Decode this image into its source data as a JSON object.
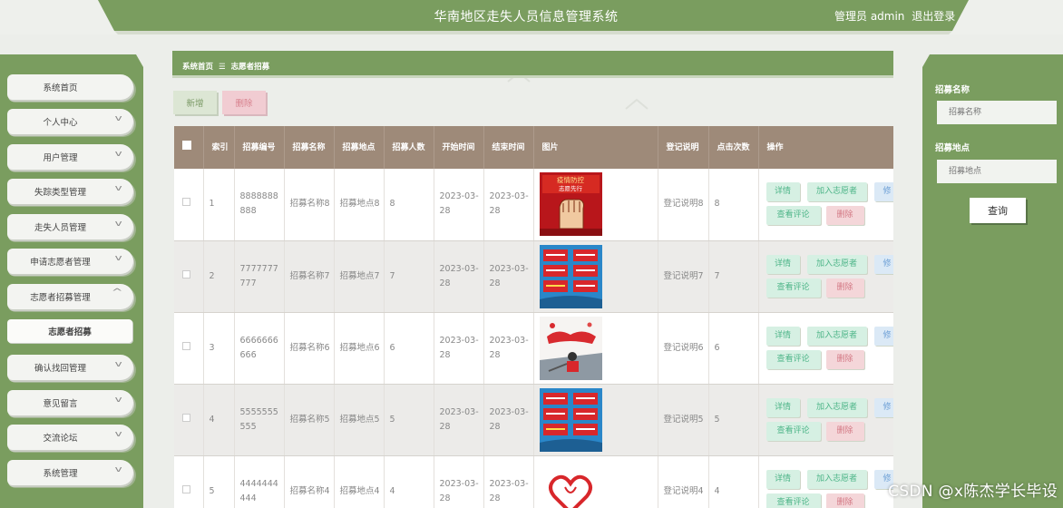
{
  "header": {
    "app_title": "华南地区走失人员信息管理系统",
    "user_label": "管理员 admin",
    "logout_label": "退出登录"
  },
  "sidebar": {
    "items": [
      {
        "label": "系统首页",
        "has_arrow": false
      },
      {
        "label": "个人中心",
        "has_arrow": true
      },
      {
        "label": "用户管理",
        "has_arrow": true
      },
      {
        "label": "失踪类型管理",
        "has_arrow": true
      },
      {
        "label": "走失人员管理",
        "has_arrow": true
      },
      {
        "label": "申请志愿者管理",
        "has_arrow": true
      },
      {
        "label": "志愿者招募管理",
        "has_arrow": true,
        "expanded": true
      },
      {
        "label": "志愿者招募",
        "sub": true
      },
      {
        "label": "确认找回管理",
        "has_arrow": true
      },
      {
        "label": "意见留言",
        "has_arrow": true
      },
      {
        "label": "交流论坛",
        "has_arrow": true
      },
      {
        "label": "系统管理",
        "has_arrow": true
      }
    ]
  },
  "breadcrumb": {
    "home": "系统首页",
    "separator": "☰",
    "current": "志愿者招募"
  },
  "toolbar": {
    "new_label": "新增",
    "delete_label": "删除"
  },
  "table": {
    "headers": {
      "index": "索引",
      "code": "招募编号",
      "name": "招募名称",
      "place": "招募地点",
      "count": "招募人数",
      "start": "开始时间",
      "end": "结束时间",
      "image": "图片",
      "note": "登记说明",
      "clicks": "点击次数",
      "ops": "操作"
    },
    "rows": [
      {
        "index": "1",
        "code": "8888888888",
        "name": "招募名称8",
        "place": "招募地点8",
        "count": "8",
        "start": "2023-03-28",
        "end": "2023-03-28",
        "image": "fist-poster",
        "note": "登记说明8",
        "clicks": "8"
      },
      {
        "index": "2",
        "code": "7777777777",
        "name": "招募名称7",
        "place": "招募地点7",
        "count": "7",
        "start": "2023-03-28",
        "end": "2023-03-28",
        "image": "blue-board-poster",
        "note": "登记说明7",
        "clicks": "7"
      },
      {
        "index": "3",
        "code": "6666666666",
        "name": "招募名称6",
        "place": "招募地点6",
        "count": "6",
        "start": "2023-03-28",
        "end": "2023-03-28",
        "image": "volunteer-photo",
        "note": "登记说明6",
        "clicks": "6"
      },
      {
        "index": "4",
        "code": "5555555555",
        "name": "招募名称5",
        "place": "招募地点5",
        "count": "5",
        "start": "2023-03-28",
        "end": "2023-03-28",
        "image": "blue-board-poster",
        "note": "登记说明5",
        "clicks": "5"
      },
      {
        "index": "5",
        "code": "4444444444",
        "name": "招募名称4",
        "place": "招募地点4",
        "count": "4",
        "start": "2023-03-28",
        "end": "2023-03-28",
        "image": "heart-poster",
        "note": "登记说明4",
        "clicks": "4"
      }
    ],
    "ops": {
      "detail": "详情",
      "join": "加入志愿者",
      "edit": "修改",
      "comment": "查看评论",
      "delete": "删除"
    }
  },
  "search_panel": {
    "name_label": "招募名称",
    "name_placeholder": "招募名称",
    "place_label": "招募地点",
    "place_placeholder": "招募地点",
    "query_label": "查询"
  },
  "poster_texts": {
    "fist_line1": "疫情防控",
    "fist_line2": "志愿先行"
  },
  "watermark": "CSDN @x陈杰学长毕设",
  "colors": {
    "brand_green": "#7a9d5f",
    "header_brown": "#9e8a79"
  }
}
